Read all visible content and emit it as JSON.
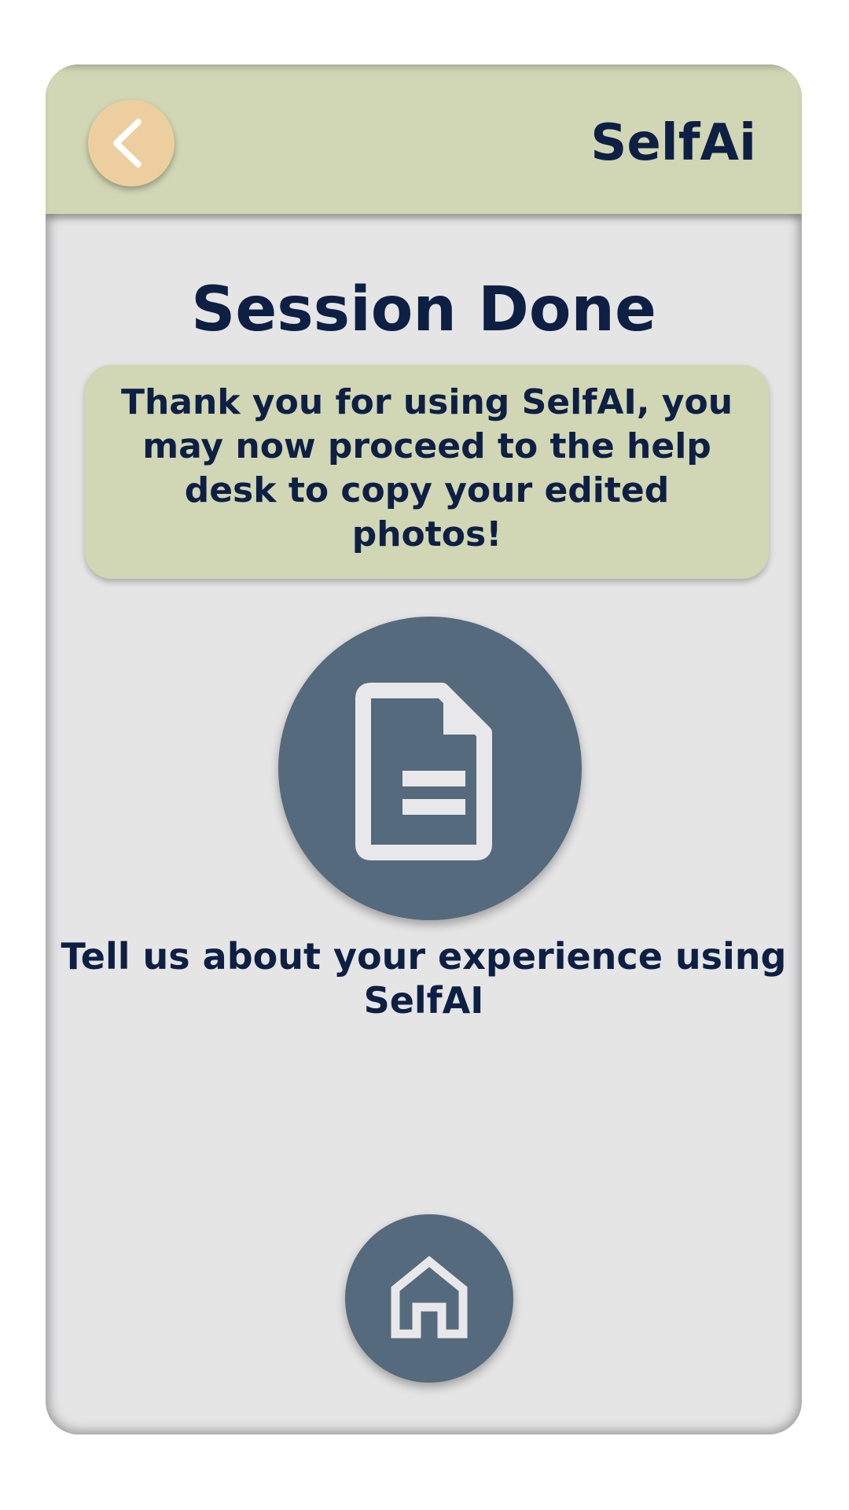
{
  "header": {
    "brand": "SelfAi",
    "back_icon": "chevron-left-icon"
  },
  "main": {
    "title": "Session Done",
    "message": "Thank you for using SelfAI, you may now proceed to the help desk to copy your edited photos!",
    "survey_icon": "document-icon",
    "survey_label": "Tell us about your experience using SelfAI"
  },
  "footer": {
    "home_icon": "home-icon"
  },
  "colors": {
    "header_bg": "#d1d6b4",
    "back_button": "#edcf9f",
    "icon_button": "#556a7c",
    "text_primary": "#0e1f44",
    "page_bg": "#e5e5e6"
  }
}
